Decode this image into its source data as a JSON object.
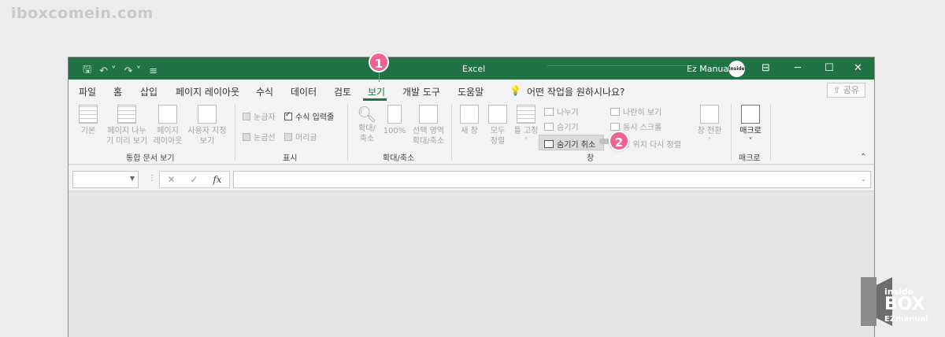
{
  "watermark": "iboxcomein.com",
  "window": {
    "title": "Excel",
    "user": "Ez Manual",
    "avatar_text": "Inside box"
  },
  "icons": {
    "save": "save-icon",
    "undo": "undo-icon",
    "redo": "redo-icon",
    "qat_more": "customize-qat-icon",
    "ribbon_display": "ribbon-display-icon",
    "minimize": "minimize-icon",
    "maximize": "maximize-icon",
    "close": "close-icon",
    "tellme": "lightbulb-icon",
    "share": "share-icon"
  },
  "tabs": [
    "파일",
    "홈",
    "삽입",
    "페이지 레이아웃",
    "수식",
    "데이터",
    "검토",
    "보기",
    "개발 도구",
    "도움말"
  ],
  "active_tab": "보기",
  "tell_me": "어떤 작업을 원하시나요?",
  "share_label": "공유",
  "ribbon": {
    "workbook_views": {
      "label": "통합 문서 보기",
      "normal": "기본",
      "pagebreak_line1": "페이지 나누",
      "pagebreak_line2": "기 미리 보기",
      "pagelayout_line1": "페이지",
      "pagelayout_line2": "레이아웃",
      "custom_line1": "사용자 지정",
      "custom_line2": "보기"
    },
    "show": {
      "label": "표시",
      "ruler": "눈금자",
      "formula_bar": "수식 입력줄",
      "gridlines": "눈금선",
      "headings": "머리글"
    },
    "zoom": {
      "label": "확대/축소",
      "zoom_line1": "확대/",
      "zoom_line2": "축소",
      "zoom100": "100%",
      "selection_line1": "선택 영역",
      "selection_line2": "확대/축소"
    },
    "window": {
      "label": "창",
      "new_window": "새 창",
      "arrange_line1": "모두",
      "arrange_line2": "정렬",
      "freeze": "틀 고정",
      "split": "나누기",
      "hide": "숨기기",
      "unhide": "숨기기 취소",
      "side_by_side": "나란히 보기",
      "sync_scroll": "동시 스크롤",
      "reset_position": "창 위치 다시 정렬",
      "switch": "창 전환"
    },
    "macros": {
      "label": "매크로",
      "macros_btn": "매크로"
    }
  },
  "formula_bar": {
    "cancel": "✕",
    "enter": "✓",
    "fx": "fx"
  },
  "callouts": [
    "1",
    "2"
  ],
  "logo": {
    "line1": "inside",
    "line2": "BOX",
    "line3": "EZmanual"
  }
}
